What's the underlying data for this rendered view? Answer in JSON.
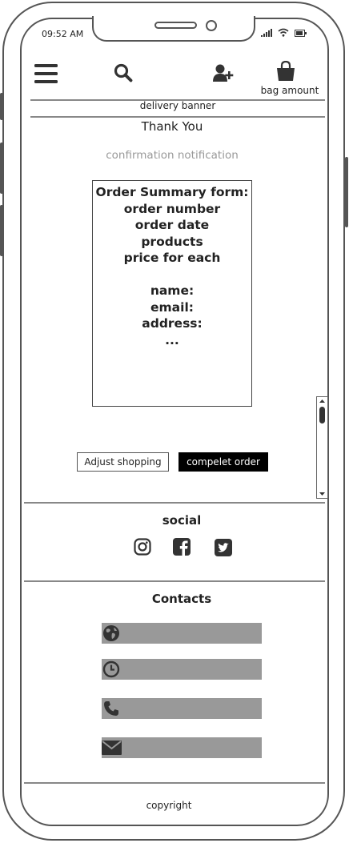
{
  "status_bar": {
    "time": "09:52 AM"
  },
  "header": {
    "menu_icon": "hamburger-icon",
    "search_icon": "search-icon",
    "account_icon": "add-user-icon",
    "bag_icon": "shopping-bag-icon",
    "bag_label": "bag amount"
  },
  "delivery_banner": "delivery banner",
  "main": {
    "heading": "Thank You",
    "confirmation": "confirmation notification",
    "order_summary": {
      "title": "Order Summary form:",
      "lines": [
        "order number",
        "order date",
        "products",
        "price for each",
        "",
        "name:",
        "email:",
        "address:",
        "..."
      ]
    },
    "buttons": {
      "adjust": "Adjust shopping",
      "complete": "compelet order"
    }
  },
  "social": {
    "title": "social",
    "icons": [
      "instagram-icon",
      "facebook-icon",
      "twitter-icon"
    ]
  },
  "contacts": {
    "title": "Contacts",
    "items": [
      "globe-icon",
      "clock-icon",
      "phone-icon",
      "mail-icon"
    ]
  },
  "footer": {
    "copyright": "copyright"
  },
  "colors": {
    "outline": "#555555",
    "bar_fill": "#999999",
    "primary_button": "#000000",
    "muted_text": "#999999"
  }
}
